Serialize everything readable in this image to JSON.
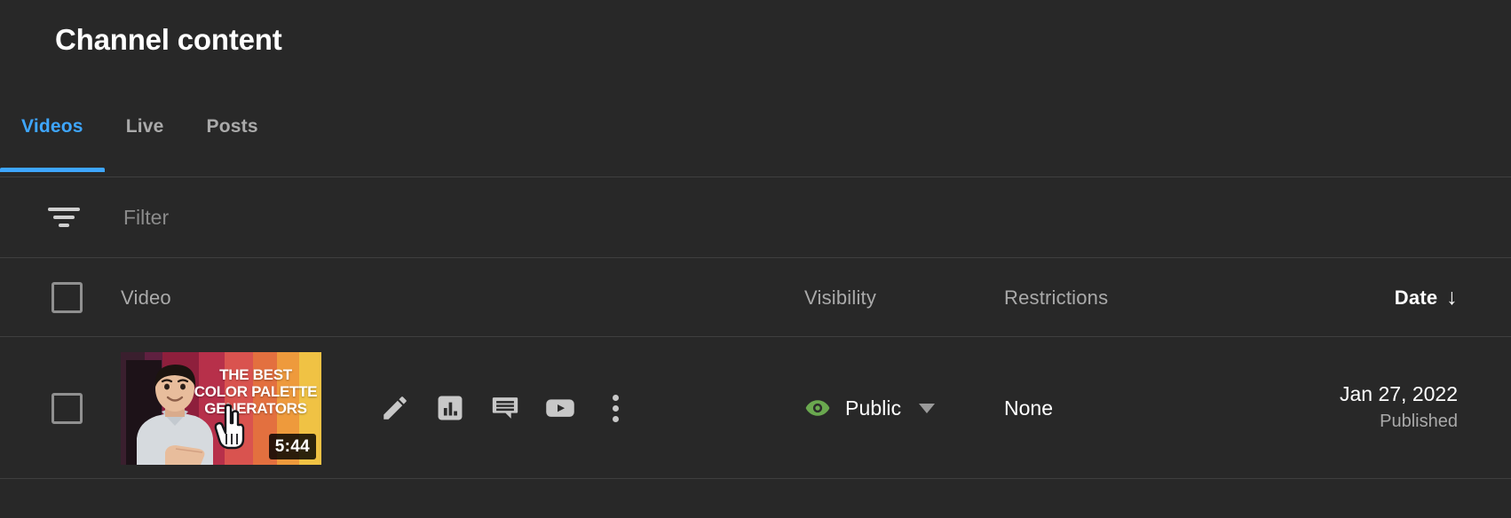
{
  "header": {
    "title": "Channel content"
  },
  "tabs": [
    {
      "label": "Videos",
      "active": true
    },
    {
      "label": "Live",
      "active": false
    },
    {
      "label": "Posts",
      "active": false
    }
  ],
  "filter": {
    "icon": "filter-icon",
    "placeholder": "Filter",
    "value": ""
  },
  "table": {
    "columns": {
      "video": "Video",
      "visibility": "Visibility",
      "restrictions": "Restrictions",
      "date": "Date",
      "sort_arrow": "↓",
      "sorted_by": "Date"
    },
    "rows": [
      {
        "selected": false,
        "thumbnail": {
          "title_lines": [
            "THE BEST",
            "COLOR PALETTE",
            "GENERATORS"
          ],
          "duration": "5:44",
          "band_colors": [
            "#3a1f2e",
            "#5e1f3d",
            "#8e1f3c",
            "#b7304a",
            "#d9534f",
            "#e3703f",
            "#ee9a3c",
            "#f0c244"
          ],
          "cursor_icon": "hand-pointer-icon"
        },
        "actions": [
          {
            "name": "edit-icon",
            "label": "Details"
          },
          {
            "name": "analytics-icon",
            "label": "Analytics"
          },
          {
            "name": "comments-icon",
            "label": "Comments"
          },
          {
            "name": "youtube-play-icon",
            "label": "Get shareable link"
          },
          {
            "name": "more-options-icon",
            "label": "Options"
          }
        ],
        "visibility": {
          "icon": "eye-icon",
          "icon_color": "#6aa84f",
          "label": "Public"
        },
        "restrictions": "None",
        "date": "Jan 27, 2022",
        "date_status": "Published"
      }
    ]
  },
  "colors": {
    "background": "#282828",
    "accent": "#3ea6ff",
    "divider": "#3f3f3f",
    "text_primary": "#ffffff",
    "text_secondary": "#aaaaaa",
    "public_green": "#6aa84f"
  }
}
